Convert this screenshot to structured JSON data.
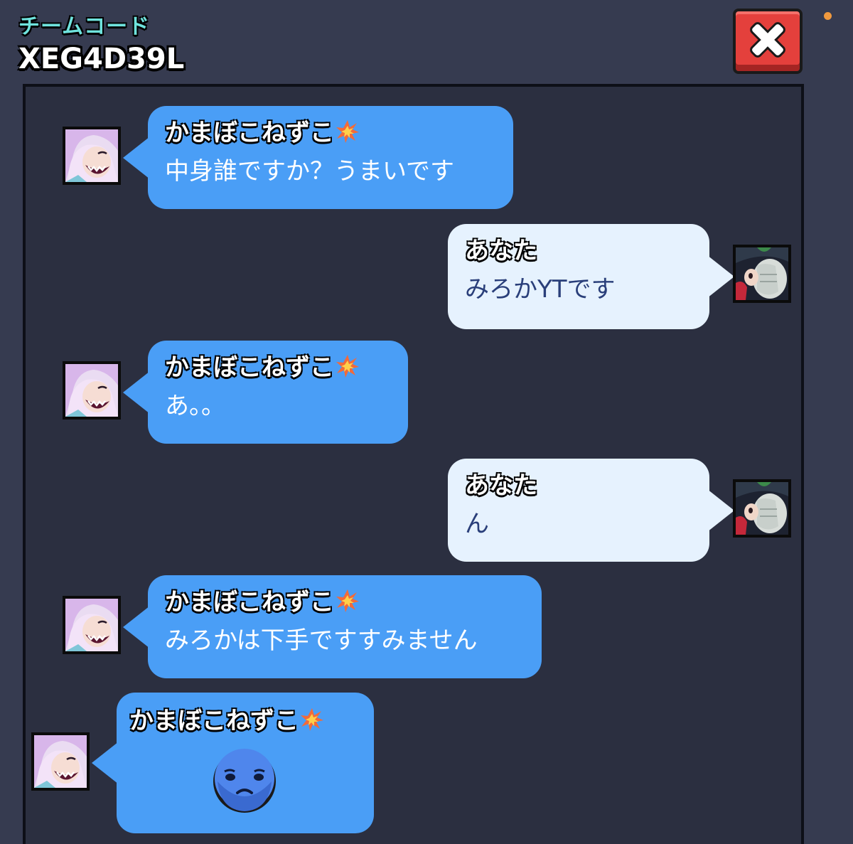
{
  "header": {
    "team_label": "チームコード",
    "team_code": "XEG4D39L",
    "close_icon": "close-x-icon"
  },
  "colors": {
    "background": "#363b50",
    "panel": "#2b2f40",
    "their_bubble": "#4a9ef6",
    "my_bubble": "#e6f2fe",
    "label_accent": "#6fe3dd",
    "close_button": "#e4403c"
  },
  "messages": [
    {
      "side": "them",
      "sender": "かまぼこねずこ",
      "sender_icon": "collision-burst-icon",
      "text": "中身誰ですか？うまいです"
    },
    {
      "side": "me",
      "sender": "あなた",
      "text": "みろかYTです"
    },
    {
      "side": "them",
      "sender": "かまぼこねずこ",
      "sender_icon": "collision-burst-icon",
      "text": "あ。。"
    },
    {
      "side": "me",
      "sender": "あなた",
      "text": "ん"
    },
    {
      "side": "them",
      "sender": "かまぼこねずこ",
      "sender_icon": "collision-burst-icon",
      "text": "みろかは下手ですすみません"
    },
    {
      "side": "them",
      "sender": "かまぼこねずこ",
      "sender_icon": "collision-burst-icon",
      "pin": "sad-face-pin-icon"
    }
  ]
}
